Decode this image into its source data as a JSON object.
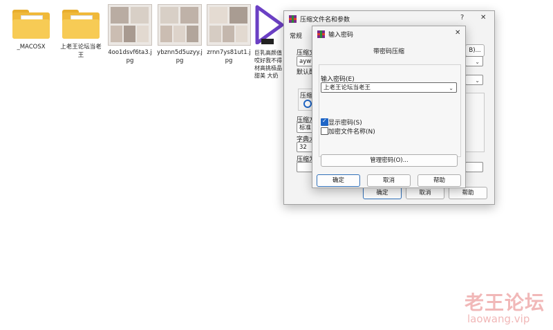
{
  "desktop": {
    "files": [
      {
        "name": "_MACOSX",
        "kind": "folder"
      },
      {
        "name": "上老王论坛当老王",
        "kind": "folder"
      },
      {
        "name": "4oo1dsvf6ta3.jpg",
        "kind": "image"
      },
      {
        "name": "ybznn5d5uzyy.jpg",
        "kind": "image"
      },
      {
        "name": "zrnn7ys81ut1.jpg",
        "kind": "image"
      },
      {
        "name": "巨乳高颜值 哎好我不得 材高挑极品 甜美 大奶",
        "kind": "video"
      }
    ]
  },
  "archive_dialog": {
    "title": "压缩文件名和参数",
    "help_glyph": "?",
    "close_glyph": "✕",
    "tab_general": "常规",
    "label_archive_name": "压缩文",
    "archive_value": "aywb. z",
    "browse_label": "B)...",
    "label_default": "默认配",
    "label_format": "压缩",
    "label_method": "压缩方",
    "method_value": "标准",
    "label_dict": "字典大",
    "dict_value": "32",
    "label_split": "压缩为",
    "ok_label": "确定",
    "cancel_label": "取消",
    "help_label": "帮助"
  },
  "password_dialog": {
    "title": "输入密码",
    "close_glyph": "✕",
    "heading": "带密码压缩",
    "label_enter_password": "输入密码(E)",
    "password_value": "上老王论坛当老王",
    "show_password_label": "显示密码(S)",
    "show_password_checked": true,
    "encrypt_filenames_label": "加密文件名称(N)",
    "encrypt_filenames_checked": false,
    "manage_passwords_label": "管理密码(O)...",
    "ok_label": "确定",
    "cancel_label": "取消",
    "help_label": "帮助"
  },
  "watermark": {
    "text": "老王论坛",
    "url": "laowang.vip"
  },
  "colors": {
    "folder": "#f0b93a",
    "accent": "#1f66c7",
    "watermark": "#f1b8b8"
  }
}
